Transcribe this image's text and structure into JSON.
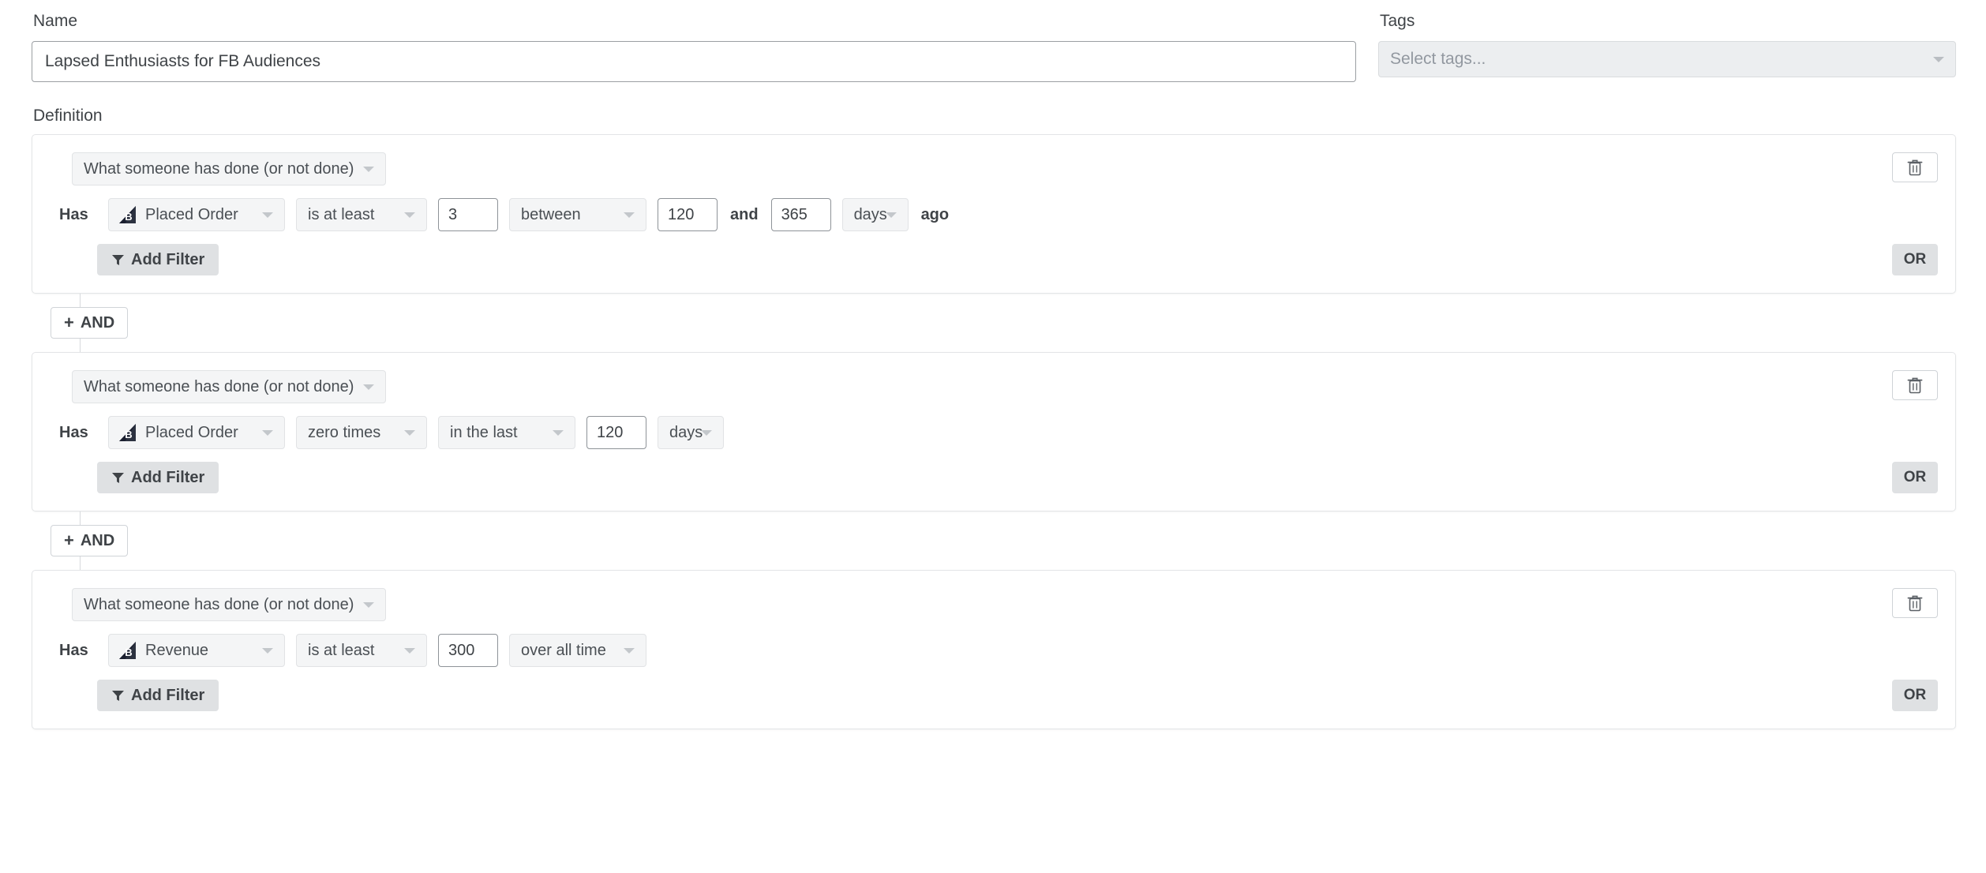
{
  "name_field": {
    "label": "Name",
    "value": "Lapsed Enthusiasts for FB Audiences",
    "placeholder": "Name"
  },
  "tags_field": {
    "label": "Tags",
    "placeholder": "Select tags...",
    "value": "",
    "caret_icon": "chevron-down-icon"
  },
  "definition": {
    "label": "Definition",
    "and_label": "AND",
    "and_plus": "+",
    "groups": [
      {
        "type_select": "What someone has done (or not done)",
        "has_label": "Has",
        "metric": "Placed Order",
        "metric_icon": "metric-triangle-icon",
        "operator": "is at least",
        "count": "3",
        "window": "between",
        "value_from": "120",
        "joiner": "and",
        "value_to": "365",
        "unit": "days",
        "suffix": "ago",
        "add_filter_label": "Add Filter",
        "filter_icon": "funnel-icon",
        "or_label": "OR",
        "delete_icon": "trash-icon"
      },
      {
        "type_select": "What someone has done (or not done)",
        "has_label": "Has",
        "metric": "Placed Order",
        "metric_icon": "metric-triangle-icon",
        "operator": "zero times",
        "count": "",
        "window": "in the last",
        "value_from": "120",
        "joiner": "",
        "value_to": "",
        "unit": "days",
        "suffix": "",
        "add_filter_label": "Add Filter",
        "filter_icon": "funnel-icon",
        "or_label": "OR",
        "delete_icon": "trash-icon"
      },
      {
        "type_select": "What someone has done (or not done)",
        "has_label": "Has",
        "metric": "Revenue",
        "metric_icon": "metric-triangle-icon",
        "operator": "is at least",
        "count": "300",
        "window": "over all time",
        "value_from": "",
        "joiner": "",
        "value_to": "",
        "unit": "",
        "suffix": "",
        "add_filter_label": "Add Filter",
        "filter_icon": "funnel-icon",
        "or_label": "OR",
        "delete_icon": "trash-icon"
      }
    ]
  },
  "colors": {
    "control_bg": "#f4f5f6",
    "button_grey": "#dfe1e3",
    "text": "#3f4347",
    "placeholder": "#9298a0",
    "border": "#e3e5e7"
  }
}
